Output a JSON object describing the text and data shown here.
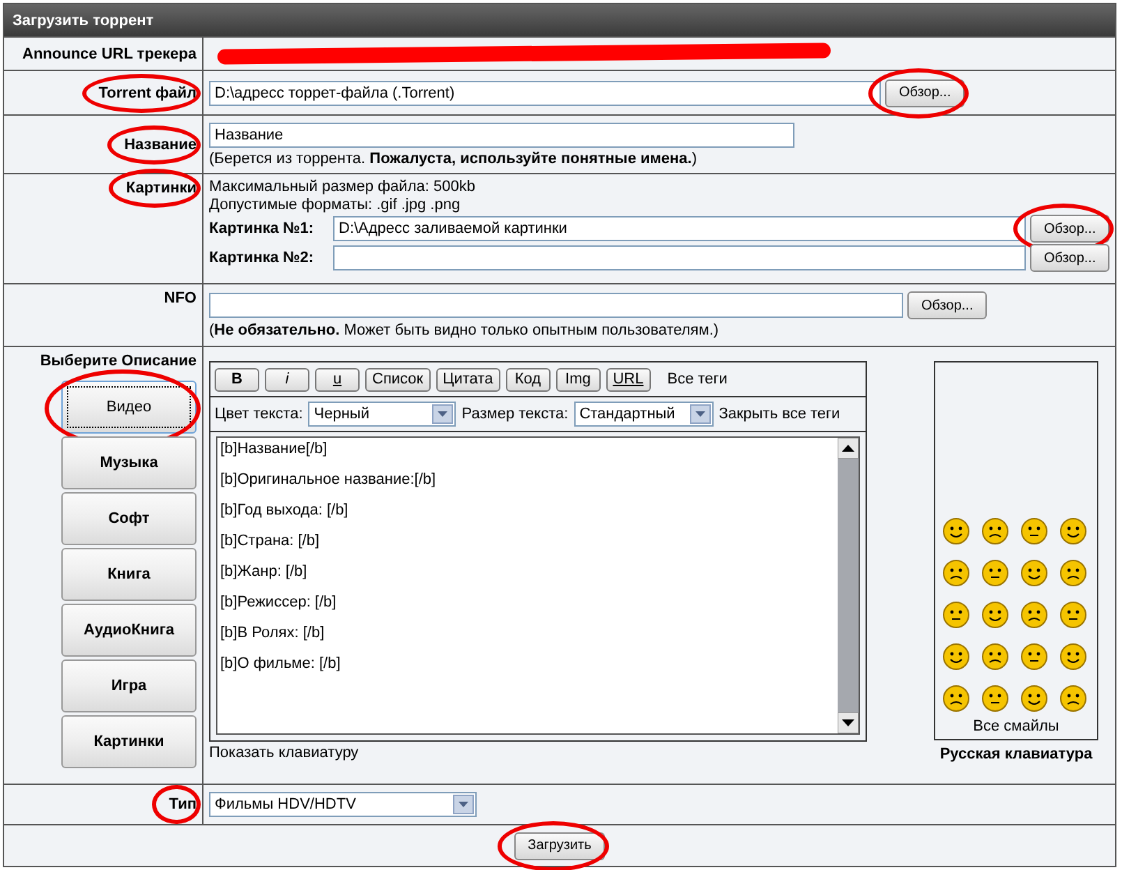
{
  "title": "Загрузить торрент",
  "announce": {
    "label": "Announce URL трекера",
    "redacted": true
  },
  "torrent": {
    "label": "Torrent файл",
    "label_circled": true,
    "value": "D:\\адресс торрет-файла (.Torrent)",
    "button": "Обзор...",
    "button_circled": true
  },
  "name": {
    "label": "Название",
    "label_circled": true,
    "value": "Название",
    "hint": "(Берется из торрента. **Пожалуста, используйте понятные имена.**)"
  },
  "pictures": {
    "label": "Картинки",
    "label_circled": true,
    "notes": [
      "Максимальный размер файла: 500kb",
      "Допустимые форматы: .gif .jpg .png"
    ],
    "inputs": [
      {
        "label": "Картинка №1:",
        "value": "D:\\Адресс заливаемой картинки",
        "button": "Обзор...",
        "button_circled": true
      },
      {
        "label": "Картинка №2:",
        "button": "Обзор...",
        "button_circled": false
      }
    ]
  },
  "nfo": {
    "label": "NFO",
    "button": "Обзор...",
    "hint": "(**Не обязательно.** Может быть видно только опытным пользователям.)"
  },
  "description": {
    "label": "Выберите Описание",
    "categories": [
      {
        "label": "Видео",
        "selected": true,
        "circled": true
      },
      {
        "label": "Музыка",
        "selected": false,
        "circled": false
      },
      {
        "label": "Софт",
        "selected": false,
        "circled": false
      },
      {
        "label": "Книга",
        "selected": false,
        "circled": false
      },
      {
        "label": "АудиоКнига",
        "selected": false,
        "circled": false
      },
      {
        "label": "Игра",
        "selected": false,
        "circled": false
      },
      {
        "label": "Картинки",
        "selected": false,
        "circled": false
      }
    ],
    "tag_buttons": [
      {
        "label": "B",
        "kind": "bold"
      },
      {
        "label": "i",
        "kind": "italic"
      },
      {
        "label": "u",
        "kind": "underline"
      },
      {
        "label": "Список",
        "kind": "plain"
      },
      {
        "label": "Цитата",
        "kind": "plain"
      },
      {
        "label": "Код",
        "kind": "plain"
      },
      {
        "label": "Img",
        "kind": "plain"
      },
      {
        "label": "URL",
        "kind": "underline"
      }
    ],
    "all_tags": "Все теги",
    "color_label": "Цвет текста:",
    "color_value": "Черный",
    "size_label": "Размер текста:",
    "size_value": "Стандартный",
    "close_tags": "Закрыть все теги",
    "lines": [
      "[b]Название[/b]",
      "[b]Оригинальное название:[/b]",
      "[b]Год выхода: [/b]",
      "[b]Страна: [/b]",
      "[b]Жанр: [/b]",
      "[b]Режиссер: [/b]",
      "[b]В Ролях: [/b]",
      "[b]О фильме: [/b]"
    ],
    "show_keyboard": "Показать клавиатуру",
    "all_smileys": "Все смайлы",
    "russian_keyboard": "Русская клавиатура"
  },
  "type": {
    "label": "Тип",
    "label_circled": true,
    "value": "Фильмы HDV/HDTV"
  },
  "submit": {
    "label": "Загрузить",
    "circled": true
  }
}
